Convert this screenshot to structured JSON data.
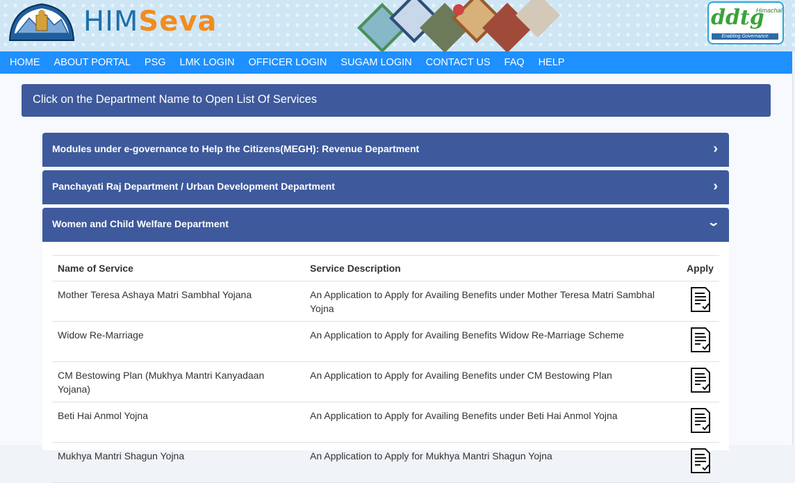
{
  "header": {
    "logo_him": "HIM",
    "logo_seva": "Seva",
    "partner_logo": {
      "text": "ddtg",
      "sub": "Himachal",
      "tagline": "Enabling Governance"
    },
    "brand_colors": {
      "him": "#1e6fa9",
      "seva": "#f28c1e",
      "nav": "#1e90ff",
      "panel": "#3e5a9c"
    }
  },
  "nav": {
    "items": [
      "HOME",
      "ABOUT PORTAL",
      "PSG",
      "LMK LOGIN",
      "OFFICER LOGIN",
      "SUGAM LOGIN",
      "CONTACT US",
      "FAQ",
      "HELP"
    ]
  },
  "banner": {
    "text": "Click on the Department Name to Open List Of Services"
  },
  "departments": [
    {
      "name": "Modules under e-governance to Help the Citizens(MEGH): Revenue Department",
      "state": "collapsed",
      "icon": "chevron-right-icon"
    },
    {
      "name": "Panchayati Raj Department / Urban Development Department",
      "state": "collapsed",
      "icon": "chevron-right-icon"
    },
    {
      "name": "Women and Child Welfare Department",
      "state": "expanded",
      "icon": "chevron-down-icon"
    }
  ],
  "services_table": {
    "headers": {
      "name": "Name of Service",
      "description": "Service Description",
      "apply": "Apply"
    },
    "rows": [
      {
        "name": "Mother Teresa Ashaya Matri Sambhal Yojana",
        "description": "An Application to Apply for Availing Benefits under Mother Teresa Matri Sambhal Yojna"
      },
      {
        "name": "Widow Re-Marriage",
        "description": "An Application to Apply for Availing Benefits Widow Re-Marriage Scheme"
      },
      {
        "name": "CM Bestowing Plan (Mukhya Mantri Kanyadaan Yojana)",
        "description": "An Application to Apply for Availing Benefits under CM Bestowing Plan"
      },
      {
        "name": "Beti Hai Anmol Yojna",
        "description": "An Application to Apply for Availing Benefits under Beti Hai Anmol Yojna"
      },
      {
        "name": "Mukhya Mantri Shagun Yojna",
        "description": "An Application to Apply for Mukhya Mantri Shagun Yojna"
      }
    ],
    "apply_icon": "apply-form-icon"
  }
}
